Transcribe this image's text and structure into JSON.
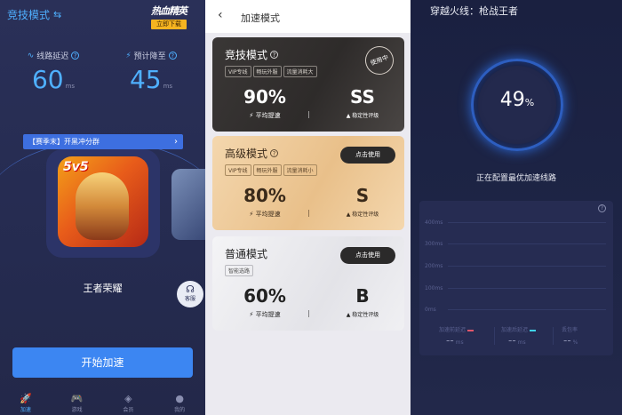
{
  "left": {
    "mode_title": "竞技模式",
    "swap_icon": "swap-icon",
    "promo": {
      "title": "热血精英",
      "button": "立即下载"
    },
    "stats": [
      {
        "label": "线路延迟",
        "value": "60",
        "unit": "ms"
      },
      {
        "label": "预计降至",
        "value": "45",
        "unit": "ms"
      }
    ],
    "banner": "【赛季末】开黑冲分群",
    "game_badge": "5v5",
    "game_name": "王者荣耀",
    "kefu_label": "客服",
    "start_label": "开始加速",
    "tabs": [
      {
        "label": "加速",
        "icon": "rocket-icon"
      },
      {
        "label": "游戏",
        "icon": "gamepad-icon"
      },
      {
        "label": "会员",
        "icon": "gem-icon"
      },
      {
        "label": "我的",
        "icon": "user-icon"
      }
    ],
    "accent": "#4fb0ff"
  },
  "middle": {
    "title": "加速模式",
    "modes": [
      {
        "name": "竞技模式",
        "tags": [
          "VIP专线",
          "畅玩外服",
          "流量消耗大"
        ],
        "pct": "90%",
        "grade": "SS",
        "pct_label": "平均提速",
        "grade_label": "稳定性评级",
        "status": "使用中"
      },
      {
        "name": "高级模式",
        "tags": [
          "VIP专线",
          "畅玩外服",
          "流量消耗小"
        ],
        "pct": "80%",
        "grade": "S",
        "pct_label": "平均提速",
        "grade_label": "稳定性评级",
        "action": "点击使用"
      },
      {
        "name": "普通模式",
        "tags": [
          "智能选路"
        ],
        "pct": "60%",
        "grade": "B",
        "pct_label": "平均提速",
        "grade_label": "稳定性评级",
        "action": "点击使用"
      }
    ]
  },
  "right": {
    "title": "穿越火线：枪战王者",
    "progress": "49",
    "progress_unit": "%",
    "status": "正在配置最优加速线路",
    "y_ticks": [
      "400ms",
      "300ms",
      "200ms",
      "100ms",
      "0ms"
    ],
    "legend": [
      {
        "label": "加速前延迟",
        "color": "#e0566a",
        "value": "--",
        "unit": "ms"
      },
      {
        "label": "加速后延迟",
        "color": "#3fd3e8",
        "value": "--",
        "unit": "ms"
      },
      {
        "label": "丢包率",
        "color": "",
        "value": "--",
        "unit": "%"
      }
    ]
  }
}
